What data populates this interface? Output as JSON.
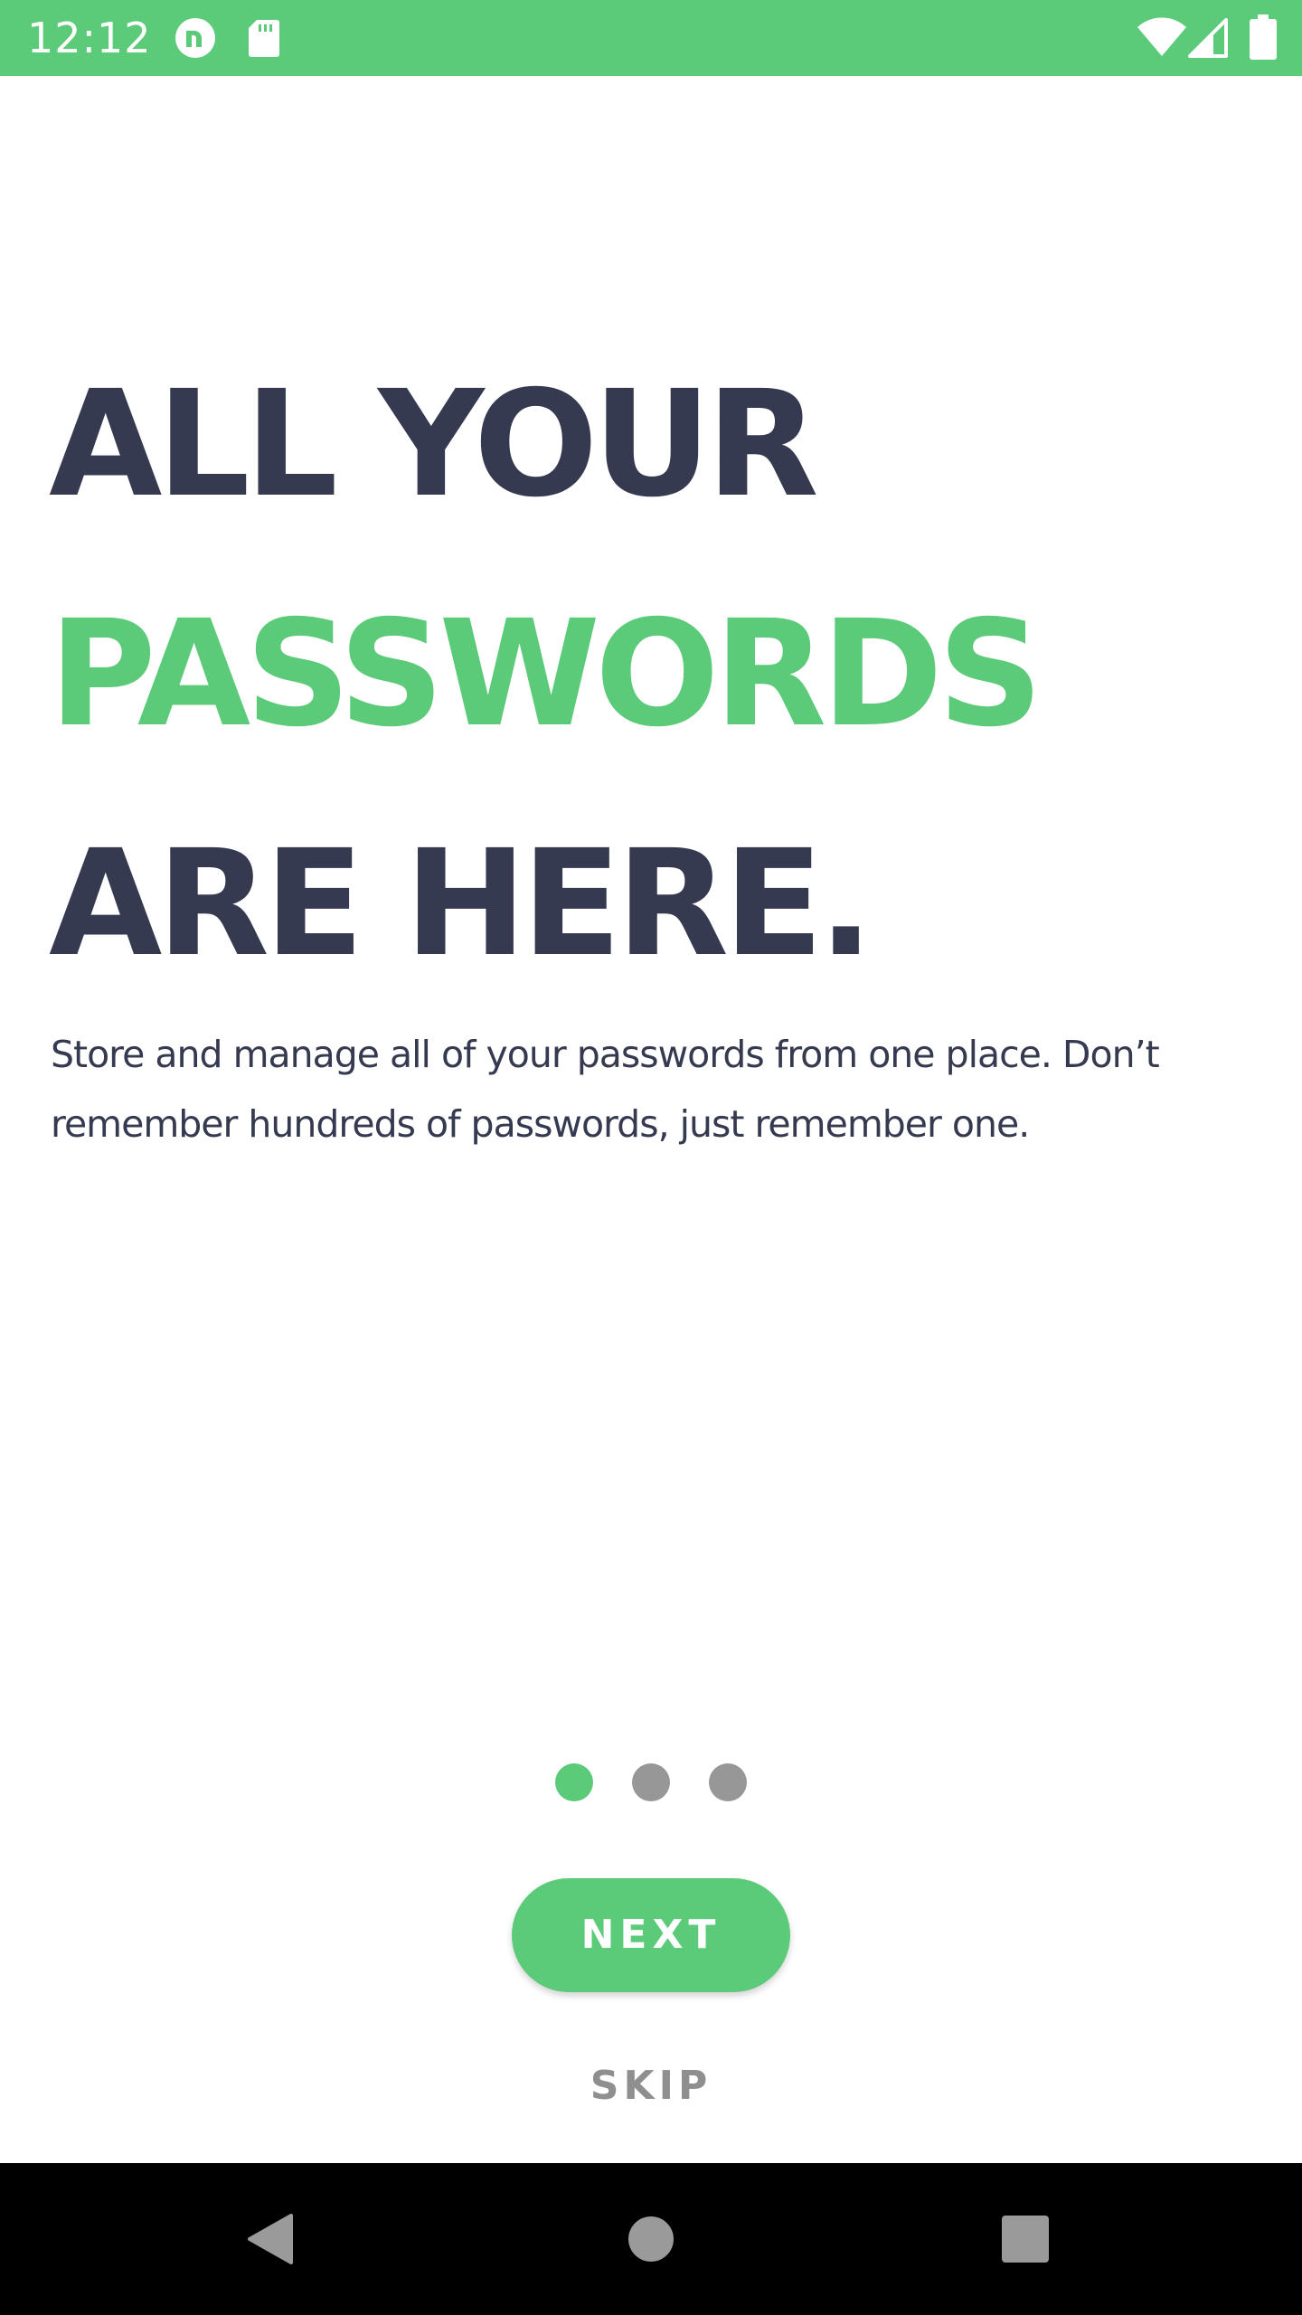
{
  "status_bar": {
    "time": "12:12",
    "background_color": "#5ccb79",
    "icons": [
      "app-notification-icon",
      "sd-card-icon",
      "wifi-icon",
      "cell-signal-icon",
      "battery-icon"
    ]
  },
  "onboarding": {
    "headline": {
      "line1": "ALL YOUR",
      "line2": "PASSWORDS",
      "line3": "ARE HERE."
    },
    "description": "Store and manage all of your passwords from one place. Don’t remember hundreds of passwords, just remember one.",
    "page_indicator": {
      "total": 3,
      "active_index": 0
    },
    "next_label": "NEXT",
    "skip_label": "SKIP"
  },
  "colors": {
    "accent": "#5ccb79",
    "text_dark": "#363a50",
    "muted": "#8f8f8f"
  },
  "nav_bar": {
    "icons": [
      "back-triangle-icon",
      "home-circle-icon",
      "recents-square-icon"
    ]
  }
}
